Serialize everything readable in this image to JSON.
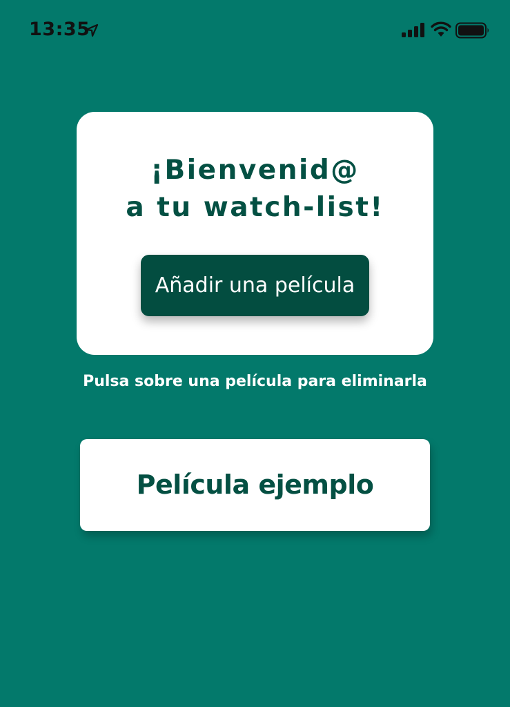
{
  "status_bar": {
    "time": "13:35",
    "icons": [
      "location-arrow-icon",
      "cellular-signal-icon",
      "wifi-icon",
      "battery-icon"
    ]
  },
  "welcome_card": {
    "title_line1": "¡Bienvenid@",
    "title_line2": "a tu watch-list!",
    "add_button_label": "Añadir una película"
  },
  "hint": "Pulsa sobre una película para eliminarla",
  "movies": [
    {
      "title": "Película ejemplo"
    }
  ],
  "colors": {
    "background": "#03796b",
    "primary_dark": "#034d40",
    "title_text": "#045043",
    "card": "#ffffff"
  }
}
